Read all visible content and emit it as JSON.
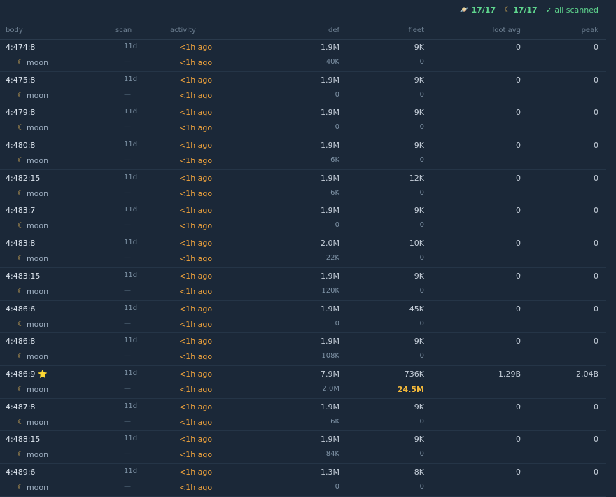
{
  "summary": {
    "planets_icon": "planet-icon",
    "planets_count": "17/17",
    "moons_icon": "moon-icon",
    "moons_count": "17/17",
    "status": "✓ all scanned"
  },
  "columns": {
    "body": "body",
    "scan": "scan",
    "activity": "activity",
    "def": "def",
    "fleet": "fleet",
    "loot": "loot avg",
    "peak": "peak"
  },
  "moon_label": "moon",
  "dash": "—",
  "rows": [
    {
      "body": "4:474:8",
      "starred": false,
      "scan": "11d",
      "activity": "<1h ago",
      "moon_activity": "<1h ago",
      "def": "1.9M",
      "moon_def": "40K",
      "fleet": "9K",
      "moon_fleet": "0",
      "moon_fleet_hi": false,
      "loot": "0",
      "peak": "0"
    },
    {
      "body": "4:475:8",
      "starred": false,
      "scan": "11d",
      "activity": "<1h ago",
      "moon_activity": "<1h ago",
      "def": "1.9M",
      "moon_def": "0",
      "fleet": "9K",
      "moon_fleet": "0",
      "moon_fleet_hi": false,
      "loot": "0",
      "peak": "0"
    },
    {
      "body": "4:479:8",
      "starred": false,
      "scan": "11d",
      "activity": "<1h ago",
      "moon_activity": "<1h ago",
      "def": "1.9M",
      "moon_def": "0",
      "fleet": "9K",
      "moon_fleet": "0",
      "moon_fleet_hi": false,
      "loot": "0",
      "peak": "0"
    },
    {
      "body": "4:480:8",
      "starred": false,
      "scan": "11d",
      "activity": "<1h ago",
      "moon_activity": "<1h ago",
      "def": "1.9M",
      "moon_def": "6K",
      "fleet": "9K",
      "moon_fleet": "0",
      "moon_fleet_hi": false,
      "loot": "0",
      "peak": "0"
    },
    {
      "body": "4:482:15",
      "starred": false,
      "scan": "11d",
      "activity": "<1h ago",
      "moon_activity": "<1h ago",
      "def": "1.9M",
      "moon_def": "6K",
      "fleet": "12K",
      "moon_fleet": "0",
      "moon_fleet_hi": false,
      "loot": "0",
      "peak": "0"
    },
    {
      "body": "4:483:7",
      "starred": false,
      "scan": "11d",
      "activity": "<1h ago",
      "moon_activity": "<1h ago",
      "def": "1.9M",
      "moon_def": "0",
      "fleet": "9K",
      "moon_fleet": "0",
      "moon_fleet_hi": false,
      "loot": "0",
      "peak": "0"
    },
    {
      "body": "4:483:8",
      "starred": false,
      "scan": "11d",
      "activity": "<1h ago",
      "moon_activity": "<1h ago",
      "def": "2.0M",
      "moon_def": "22K",
      "fleet": "10K",
      "moon_fleet": "0",
      "moon_fleet_hi": false,
      "loot": "0",
      "peak": "0"
    },
    {
      "body": "4:483:15",
      "starred": false,
      "scan": "11d",
      "activity": "<1h ago",
      "moon_activity": "<1h ago",
      "def": "1.9M",
      "moon_def": "120K",
      "fleet": "9K",
      "moon_fleet": "0",
      "moon_fleet_hi": false,
      "loot": "0",
      "peak": "0"
    },
    {
      "body": "4:486:6",
      "starred": false,
      "scan": "11d",
      "activity": "<1h ago",
      "moon_activity": "<1h ago",
      "def": "1.9M",
      "moon_def": "0",
      "fleet": "45K",
      "moon_fleet": "0",
      "moon_fleet_hi": false,
      "loot": "0",
      "peak": "0"
    },
    {
      "body": "4:486:8",
      "starred": false,
      "scan": "11d",
      "activity": "<1h ago",
      "moon_activity": "<1h ago",
      "def": "1.9M",
      "moon_def": "108K",
      "fleet": "9K",
      "moon_fleet": "0",
      "moon_fleet_hi": false,
      "loot": "0",
      "peak": "0"
    },
    {
      "body": "4:486:9",
      "starred": true,
      "scan": "11d",
      "activity": "<1h ago",
      "moon_activity": "<1h ago",
      "def": "7.9M",
      "moon_def": "2.0M",
      "fleet": "736K",
      "moon_fleet": "24.5M",
      "moon_fleet_hi": true,
      "loot": "1.29B",
      "peak": "2.04B"
    },
    {
      "body": "4:487:8",
      "starred": false,
      "scan": "11d",
      "activity": "<1h ago",
      "moon_activity": "<1h ago",
      "def": "1.9M",
      "moon_def": "6K",
      "fleet": "9K",
      "moon_fleet": "0",
      "moon_fleet_hi": false,
      "loot": "0",
      "peak": "0"
    },
    {
      "body": "4:488:15",
      "starred": false,
      "scan": "11d",
      "activity": "<1h ago",
      "moon_activity": "<1h ago",
      "def": "1.9M",
      "moon_def": "84K",
      "fleet": "9K",
      "moon_fleet": "0",
      "moon_fleet_hi": false,
      "loot": "0",
      "peak": "0"
    },
    {
      "body": "4:489:6",
      "starred": false,
      "scan": "11d",
      "activity": "<1h ago",
      "moon_activity": "<1h ago",
      "def": "1.3M",
      "moon_def": "0",
      "fleet": "8K",
      "moon_fleet": "0",
      "moon_fleet_hi": false,
      "loot": "0",
      "peak": "0"
    }
  ]
}
